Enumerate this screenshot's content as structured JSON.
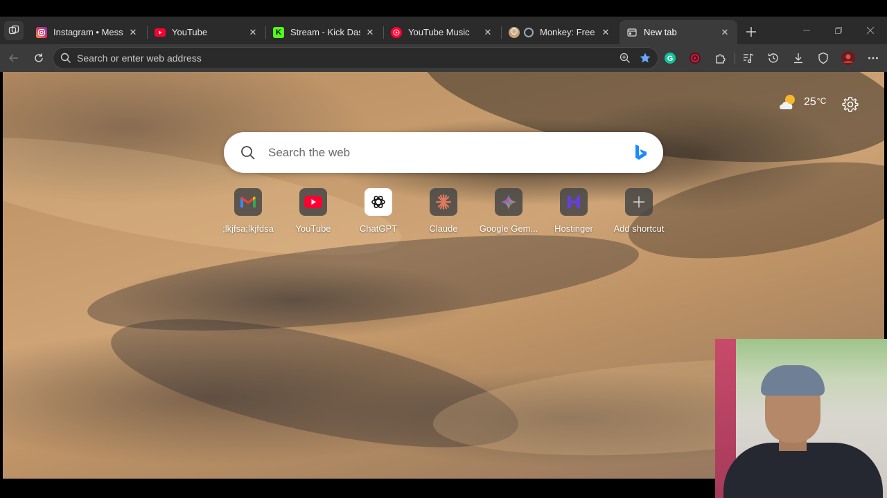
{
  "tabs": [
    {
      "title": "Instagram • Messages",
      "favicon": "instagram-icon",
      "active": false
    },
    {
      "title": "YouTube",
      "favicon": "youtube-icon",
      "active": false
    },
    {
      "title": "Stream - Kick Dashboard",
      "favicon": "kick-icon",
      "active": false
    },
    {
      "title": "YouTube Music",
      "favicon": "youtube-music-icon",
      "active": false
    },
    {
      "title": "Monkey: Free Live",
      "favicon": "monkey-icon",
      "active": false
    },
    {
      "title": "New tab",
      "favicon": "newtab-icon",
      "active": true
    }
  ],
  "addressbar": {
    "placeholder": "Search or enter web address"
  },
  "weather": {
    "temperature": "25",
    "unit": "°C",
    "icon": "partly-cloudy-icon"
  },
  "search": {
    "placeholder": "Search the web"
  },
  "shortcuts": [
    {
      "label": ";lkjfsa;lkjfdsa",
      "icon": "gmail-icon"
    },
    {
      "label": "YouTube",
      "icon": "youtube-icon"
    },
    {
      "label": "ChatGPT",
      "icon": "chatgpt-icon"
    },
    {
      "label": "Claude",
      "icon": "claude-icon"
    },
    {
      "label": "Google Gem...",
      "icon": "gemini-icon"
    },
    {
      "label": "Hostinger",
      "icon": "hostinger-icon"
    },
    {
      "label": "Add shortcut",
      "icon": "plus-icon"
    }
  ],
  "colors": {
    "tabstrip": "#2b2b2b",
    "toolbar": "#3b3b3b",
    "accent": "#4a8cff"
  }
}
